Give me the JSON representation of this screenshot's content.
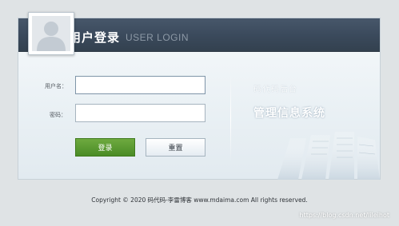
{
  "header": {
    "title": "用户登录",
    "subtitle": "USER LOGIN",
    "avatar_icon": "user-silhouette-icon"
  },
  "form": {
    "username_label": "用户名：",
    "username_value": "",
    "password_label": "密码：",
    "password_value": "",
    "login_button": "登录",
    "reset_button": "重置"
  },
  "branding": {
    "small_text": "码代码后台",
    "large_text": "管理信息系统",
    "graphic_icon": "server-rack-icon"
  },
  "footer": {
    "copyright": "Copyright © 2020 码代码-李雷博客 www.mdaima.com All rights reserved.",
    "watermark": "https://blog.csdn.net/lileihot"
  },
  "colors": {
    "header_bg": "#3a495b",
    "login_button_bg": "#4a8b26",
    "page_bg": "#dfe3e5"
  }
}
